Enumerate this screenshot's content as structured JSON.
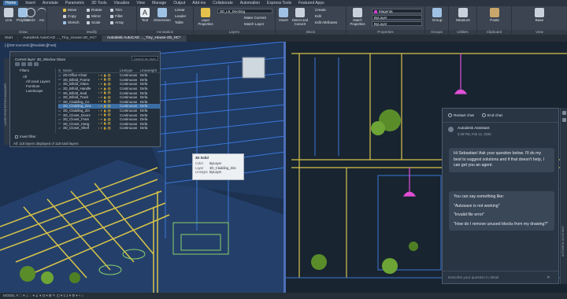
{
  "menu": [
    "Home",
    "Insert",
    "Annotate",
    "Parametric",
    "3D Tools",
    "Visualize",
    "View",
    "Manage",
    "Output",
    "Add-ins",
    "Collaborate",
    "Automation",
    "Express Tools",
    "Featured Apps"
  ],
  "ribbon": {
    "draw": {
      "line": "Line",
      "polyline": "Polyline",
      "circle": "Circle",
      "arc": "Arc",
      "label": "Draw"
    },
    "modify": {
      "move": "Move",
      "rotate": "Rotate",
      "trim": "Trim",
      "copy": "Copy",
      "mirror": "Mirror",
      "fillet": "Fillet",
      "stretch": "Stretch",
      "scale": "Scale",
      "array": "Array",
      "label": "Modify"
    },
    "annotation": {
      "text": "Text",
      "dimension": "Dimension",
      "linear": "Linear",
      "leader": "Leader",
      "table": "Table",
      "label": "Annotation"
    },
    "layers": {
      "properties": "Layer Properties",
      "current_layer": "3D_L5_Decking",
      "make_current": "Make Current",
      "match_layer": "Match Layer",
      "label": "Layers"
    },
    "block": {
      "insert": "Insert",
      "create": "Create",
      "edit": "Edit",
      "edit_attributes": "Edit Attributes",
      "label": "Block",
      "detect": "Detect and Convert"
    },
    "properties": {
      "match": "Match Properties",
      "color": "Magenta",
      "linetype": "ByLayer",
      "lineweight": "ByLayer",
      "label": "Properties"
    },
    "groups": {
      "group": "Group",
      "label": "Groups"
    },
    "utilities": {
      "measure": "Measure",
      "label": "Utilities"
    },
    "clipboard": {
      "paste": "Paste",
      "label": "Clipboard"
    },
    "view": {
      "base": "Base",
      "label": "View"
    }
  },
  "tabs": [
    "Start",
    "Autodesk AutoCAD ..._Tiny_House-2D_HC*",
    "Autodesk AutoCAD ..._Tiny_House-3D_HC*"
  ],
  "viewport_label": "[-][SW Isometric][Realistic][Fast]",
  "layer_panel": {
    "current_layer": "Current layer: 3D_Window Glass",
    "search_placeholder": "Search for layer",
    "filters_title": "Filters",
    "filters": [
      "All",
      "All Used Layers",
      "Furniture",
      "Landscape"
    ],
    "columns": {
      "status": "S",
      "name": "Name",
      "linetype": "Linetype",
      "lineweight": "Lineweight"
    },
    "rows": [
      {
        "name": "2D-Office-Chair",
        "icons": "♀☀🔒🖨",
        "linetype": "Continuous",
        "lineweight": "Defa",
        "selected": false
      },
      {
        "name": "3D_Bifold_Frame",
        "icons": "♀☀🔒🖨",
        "linetype": "Continuous",
        "lineweight": "Defa",
        "selected": false
      },
      {
        "name": "3D_Bifold_Glass",
        "icons": "♀☀🔒🖨",
        "linetype": "Continuous",
        "lineweight": "Defa",
        "selected": false
      },
      {
        "name": "3D_Bifold_Handle",
        "icons": "♀☀🔒🖨",
        "linetype": "Continuous",
        "lineweight": "Defa",
        "selected": false
      },
      {
        "name": "3D_Bifold_Seal",
        "icons": "♀☀🔒🖨",
        "linetype": "Continuous",
        "lineweight": "Defa",
        "selected": false
      },
      {
        "name": "3D_Bifold_Track",
        "icons": "♀☀🔒🖨",
        "linetype": "Continuous",
        "lineweight": "Defa",
        "selected": false
      },
      {
        "name": "3D_Cladding_Co",
        "icons": "♀☀🔒🖨",
        "linetype": "Continuous",
        "lineweight": "Defa",
        "selected": false
      },
      {
        "name": "3D_Cladding_Zinc",
        "icons": "♀☀🔒🖨",
        "linetype": "Continuous",
        "lineweight": "Defa",
        "selected": true
      },
      {
        "name": "3D_Cladding_Zin",
        "icons": "♀☀🔒🖨",
        "linetype": "Continuous",
        "lineweight": "Defa",
        "selected": false
      },
      {
        "name": "3D_Closet_Doors",
        "icons": "♀☀🔒🖨",
        "linetype": "Continuous",
        "lineweight": "Defa",
        "selected": false
      },
      {
        "name": "3D_Closet_Fram",
        "icons": "♀☀🔒🖨",
        "linetype": "Continuous",
        "lineweight": "Defa",
        "selected": false
      },
      {
        "name": "3D_Closet_Hang",
        "icons": "♀☀🔒🖨",
        "linetype": "Continuous",
        "lineweight": "Defa",
        "selected": false
      },
      {
        "name": "3D_Closet_Shelf",
        "icons": "♀☀🔒🖨",
        "linetype": "Continuous",
        "lineweight": "Defa",
        "selected": false
      }
    ],
    "invert_filter": "Invert filter",
    "status": "All: 118 layers displayed of 118 total layers",
    "side_title": "LAYER PROPERTIES MANAGER"
  },
  "tooltip": {
    "title": "3D Solid",
    "rows": [
      {
        "key": "Color",
        "value": "ByLayer"
      },
      {
        "key": "Layer",
        "value": "3D_Cladding_Zinc"
      },
      {
        "key": "Linetype",
        "value": "ByLayer"
      }
    ]
  },
  "assistant": {
    "restart": "Restart chat",
    "end": "End chat",
    "bot_name": "Autodesk Assistant",
    "timestamp": "3:38 PM, Feb 12, 2025",
    "greeting": "Hi Sebastian! Ask your question below. I'll do my best to suggest solutions and if that doesn't help, I can get you an agent.",
    "suggest_intro": "You can say something like:",
    "suggestions": [
      "\"Autosave is not working\"",
      "\"Invalid file error\"",
      "\"How do I remove unused blocks from my drawing?\""
    ],
    "input_placeholder": "Describe your question in detail",
    "side_title": "AUTODESK ASSISTANT"
  },
  "statusbar": "MODEL   # ::: ▾ ⊥ ◌ ▾ ∠ ▾ ⊡ ▾ ⊞ ✎ ◫ ▾ 1:1 ▾ ⚙ ▾ + ⌂"
}
